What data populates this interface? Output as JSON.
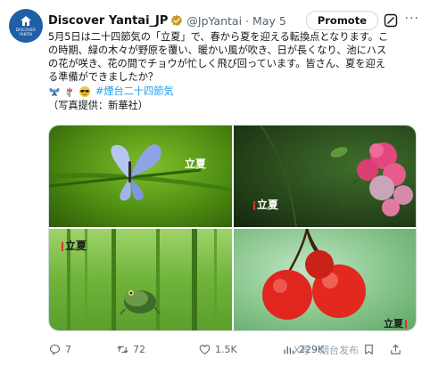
{
  "post": {
    "display_name": "Discover Yantai_JP",
    "handle": "@JpYantai",
    "separator": "·",
    "date": "May 5",
    "promote_label": "Promote",
    "more_label": "···",
    "avatar_text_line1": "DISCOVER",
    "avatar_text_line2": "YANTAI",
    "body_lines": [
      "5月5日は二十四節気の「立夏」で、春から夏を迎える転換点となります。こ",
      "の時期、緑の木々が野原を覆い、暖かい風が吹き、日が長くなり、池にハス",
      "の花が咲き、花の間でチョウが忙しく飛び回っています。皆さん、夏を迎え",
      "る準備ができましたか？"
    ],
    "hashtag": "#煙台二十四節気",
    "credit": "（写真提供：新華社）",
    "emojis": [
      "butterfly-emoji",
      "tulip-emoji",
      "sunglasses-emoji"
    ]
  },
  "media": {
    "tiles": [
      {
        "caption": "立夏",
        "subject": "butterfly on grass"
      },
      {
        "caption": "立夏",
        "subject": "pink roses"
      },
      {
        "caption": "立夏",
        "subject": "frog among reeds"
      },
      {
        "caption": "立夏",
        "subject": "red cherries"
      }
    ]
  },
  "actions": {
    "replies": "7",
    "reposts": "72",
    "likes": "1.5K",
    "views": "229K",
    "icons": [
      "reply-icon",
      "repost-icon",
      "like-icon",
      "views-icon",
      "bookmark-icon",
      "share-icon"
    ]
  },
  "watermark": "X号 · 烟台发布",
  "colors": {
    "link": "#1d9bf0",
    "secondary_text": "#536471",
    "verified": "#c79a1b",
    "avatar_bg": "#1f5fa8"
  }
}
